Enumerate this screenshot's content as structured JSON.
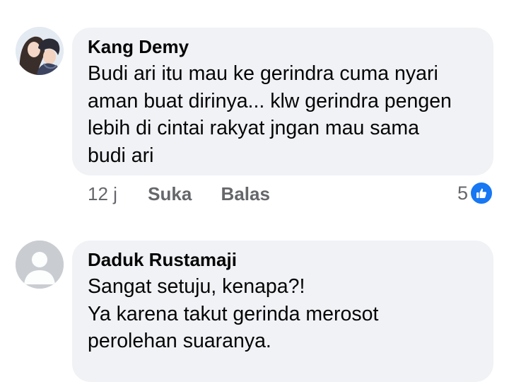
{
  "comments": [
    {
      "author": "Kang Demy",
      "text": "Budi ari itu mau ke gerindra cuma nyari\naman buat dirinya... klw gerindra pengen\nlebih di cintai rakyat jngan mau sama\nbudi ari",
      "time": "12 j",
      "like_label": "Suka",
      "reply_label": "Balas",
      "reaction_count": "5",
      "reaction_icon": "thumbs-up-icon",
      "reaction_color": "#1877f2"
    },
    {
      "author": "Daduk Rustamaji",
      "text": "Sangat setuju, kenapa?!\nYa karena takut gerinda merosot\nperolehan suaranya."
    }
  ]
}
